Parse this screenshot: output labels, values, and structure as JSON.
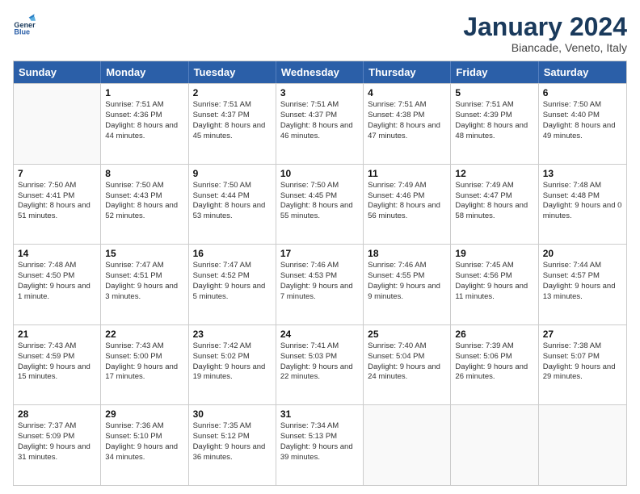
{
  "header": {
    "logo_line1": "General",
    "logo_line2": "Blue",
    "month": "January 2024",
    "location": "Biancade, Veneto, Italy"
  },
  "days_of_week": [
    "Sunday",
    "Monday",
    "Tuesday",
    "Wednesday",
    "Thursday",
    "Friday",
    "Saturday"
  ],
  "weeks": [
    [
      {
        "day": "",
        "sunrise": "",
        "sunset": "",
        "daylight": "",
        "empty": true
      },
      {
        "day": "1",
        "sunrise": "Sunrise: 7:51 AM",
        "sunset": "Sunset: 4:36 PM",
        "daylight": "Daylight: 8 hours and 44 minutes."
      },
      {
        "day": "2",
        "sunrise": "Sunrise: 7:51 AM",
        "sunset": "Sunset: 4:37 PM",
        "daylight": "Daylight: 8 hours and 45 minutes."
      },
      {
        "day": "3",
        "sunrise": "Sunrise: 7:51 AM",
        "sunset": "Sunset: 4:37 PM",
        "daylight": "Daylight: 8 hours and 46 minutes."
      },
      {
        "day": "4",
        "sunrise": "Sunrise: 7:51 AM",
        "sunset": "Sunset: 4:38 PM",
        "daylight": "Daylight: 8 hours and 47 minutes."
      },
      {
        "day": "5",
        "sunrise": "Sunrise: 7:51 AM",
        "sunset": "Sunset: 4:39 PM",
        "daylight": "Daylight: 8 hours and 48 minutes."
      },
      {
        "day": "6",
        "sunrise": "Sunrise: 7:50 AM",
        "sunset": "Sunset: 4:40 PM",
        "daylight": "Daylight: 8 hours and 49 minutes."
      }
    ],
    [
      {
        "day": "7",
        "sunrise": "Sunrise: 7:50 AM",
        "sunset": "Sunset: 4:41 PM",
        "daylight": "Daylight: 8 hours and 51 minutes."
      },
      {
        "day": "8",
        "sunrise": "Sunrise: 7:50 AM",
        "sunset": "Sunset: 4:43 PM",
        "daylight": "Daylight: 8 hours and 52 minutes."
      },
      {
        "day": "9",
        "sunrise": "Sunrise: 7:50 AM",
        "sunset": "Sunset: 4:44 PM",
        "daylight": "Daylight: 8 hours and 53 minutes."
      },
      {
        "day": "10",
        "sunrise": "Sunrise: 7:50 AM",
        "sunset": "Sunset: 4:45 PM",
        "daylight": "Daylight: 8 hours and 55 minutes."
      },
      {
        "day": "11",
        "sunrise": "Sunrise: 7:49 AM",
        "sunset": "Sunset: 4:46 PM",
        "daylight": "Daylight: 8 hours and 56 minutes."
      },
      {
        "day": "12",
        "sunrise": "Sunrise: 7:49 AM",
        "sunset": "Sunset: 4:47 PM",
        "daylight": "Daylight: 8 hours and 58 minutes."
      },
      {
        "day": "13",
        "sunrise": "Sunrise: 7:48 AM",
        "sunset": "Sunset: 4:48 PM",
        "daylight": "Daylight: 9 hours and 0 minutes."
      }
    ],
    [
      {
        "day": "14",
        "sunrise": "Sunrise: 7:48 AM",
        "sunset": "Sunset: 4:50 PM",
        "daylight": "Daylight: 9 hours and 1 minute."
      },
      {
        "day": "15",
        "sunrise": "Sunrise: 7:47 AM",
        "sunset": "Sunset: 4:51 PM",
        "daylight": "Daylight: 9 hours and 3 minutes."
      },
      {
        "day": "16",
        "sunrise": "Sunrise: 7:47 AM",
        "sunset": "Sunset: 4:52 PM",
        "daylight": "Daylight: 9 hours and 5 minutes."
      },
      {
        "day": "17",
        "sunrise": "Sunrise: 7:46 AM",
        "sunset": "Sunset: 4:53 PM",
        "daylight": "Daylight: 9 hours and 7 minutes."
      },
      {
        "day": "18",
        "sunrise": "Sunrise: 7:46 AM",
        "sunset": "Sunset: 4:55 PM",
        "daylight": "Daylight: 9 hours and 9 minutes."
      },
      {
        "day": "19",
        "sunrise": "Sunrise: 7:45 AM",
        "sunset": "Sunset: 4:56 PM",
        "daylight": "Daylight: 9 hours and 11 minutes."
      },
      {
        "day": "20",
        "sunrise": "Sunrise: 7:44 AM",
        "sunset": "Sunset: 4:57 PM",
        "daylight": "Daylight: 9 hours and 13 minutes."
      }
    ],
    [
      {
        "day": "21",
        "sunrise": "Sunrise: 7:43 AM",
        "sunset": "Sunset: 4:59 PM",
        "daylight": "Daylight: 9 hours and 15 minutes."
      },
      {
        "day": "22",
        "sunrise": "Sunrise: 7:43 AM",
        "sunset": "Sunset: 5:00 PM",
        "daylight": "Daylight: 9 hours and 17 minutes."
      },
      {
        "day": "23",
        "sunrise": "Sunrise: 7:42 AM",
        "sunset": "Sunset: 5:02 PM",
        "daylight": "Daylight: 9 hours and 19 minutes."
      },
      {
        "day": "24",
        "sunrise": "Sunrise: 7:41 AM",
        "sunset": "Sunset: 5:03 PM",
        "daylight": "Daylight: 9 hours and 22 minutes."
      },
      {
        "day": "25",
        "sunrise": "Sunrise: 7:40 AM",
        "sunset": "Sunset: 5:04 PM",
        "daylight": "Daylight: 9 hours and 24 minutes."
      },
      {
        "day": "26",
        "sunrise": "Sunrise: 7:39 AM",
        "sunset": "Sunset: 5:06 PM",
        "daylight": "Daylight: 9 hours and 26 minutes."
      },
      {
        "day": "27",
        "sunrise": "Sunrise: 7:38 AM",
        "sunset": "Sunset: 5:07 PM",
        "daylight": "Daylight: 9 hours and 29 minutes."
      }
    ],
    [
      {
        "day": "28",
        "sunrise": "Sunrise: 7:37 AM",
        "sunset": "Sunset: 5:09 PM",
        "daylight": "Daylight: 9 hours and 31 minutes."
      },
      {
        "day": "29",
        "sunrise": "Sunrise: 7:36 AM",
        "sunset": "Sunset: 5:10 PM",
        "daylight": "Daylight: 9 hours and 34 minutes."
      },
      {
        "day": "30",
        "sunrise": "Sunrise: 7:35 AM",
        "sunset": "Sunset: 5:12 PM",
        "daylight": "Daylight: 9 hours and 36 minutes."
      },
      {
        "day": "31",
        "sunrise": "Sunrise: 7:34 AM",
        "sunset": "Sunset: 5:13 PM",
        "daylight": "Daylight: 9 hours and 39 minutes."
      },
      {
        "day": "",
        "sunrise": "",
        "sunset": "",
        "daylight": "",
        "empty": true
      },
      {
        "day": "",
        "sunrise": "",
        "sunset": "",
        "daylight": "",
        "empty": true
      },
      {
        "day": "",
        "sunrise": "",
        "sunset": "",
        "daylight": "",
        "empty": true
      }
    ]
  ]
}
